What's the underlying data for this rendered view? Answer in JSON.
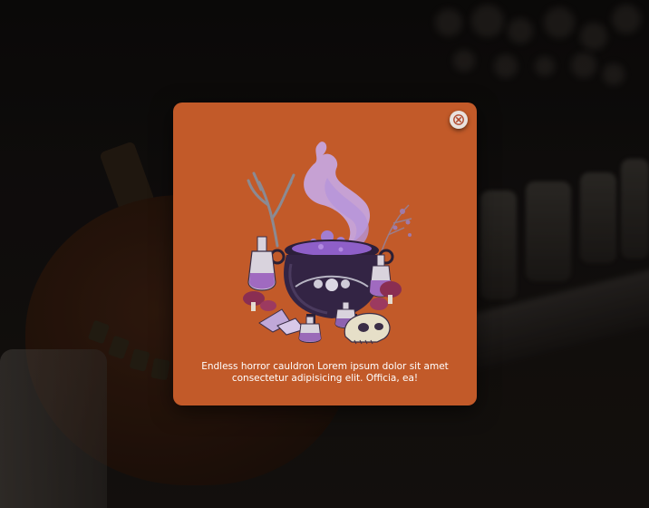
{
  "modal": {
    "message": "Endless horror cauldron Lorem ipsum dolor sit amet consectetur adipisicing elit. Officia, ea!",
    "background_color": "#c25a29",
    "close_icon": "close-icon"
  },
  "illustration": {
    "subject": "witch cauldron with purple smoke, potion bottles and skull",
    "icon": "cauldron-illustration"
  },
  "backdrop": {
    "subject": "blurred dark halloween scene with pumpkin and candle jars"
  }
}
